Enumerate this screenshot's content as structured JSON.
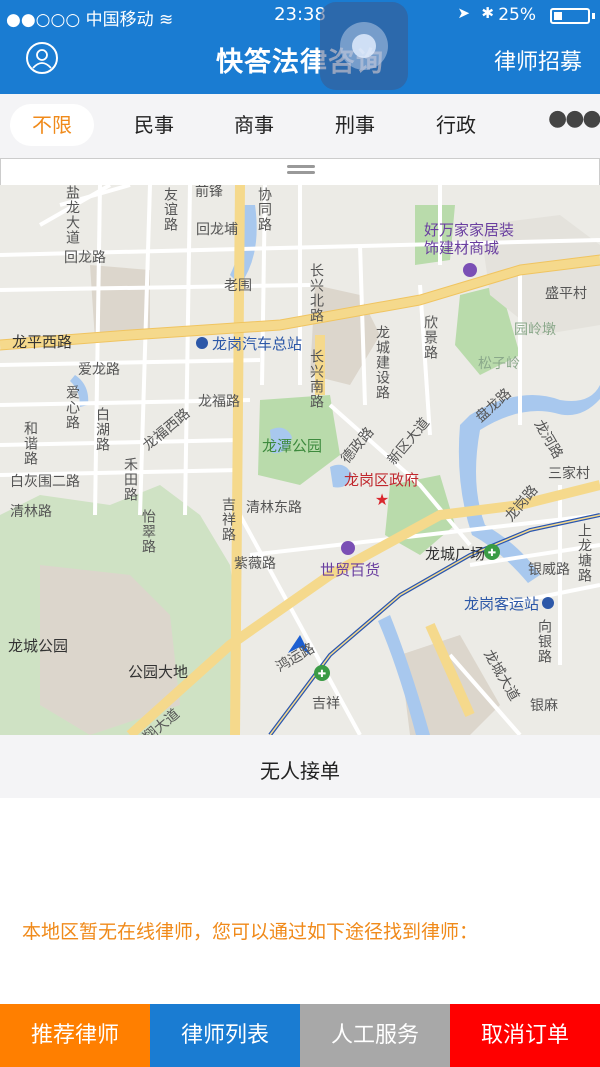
{
  "status_bar": {
    "carrier": "●●○○○ 中国移动 ≋",
    "time": "23:38",
    "battery": "25%",
    "battery_level": 0.25
  },
  "header": {
    "title": "快答法律咨询",
    "recruit_label": "律师招募"
  },
  "tabs": [
    {
      "label": "不限",
      "active": true
    },
    {
      "label": "民事"
    },
    {
      "label": "商事"
    },
    {
      "label": "刑事"
    },
    {
      "label": "行政"
    }
  ],
  "more_label": "●●●",
  "map": {
    "roads": [
      "盐龙大道",
      "友谊路",
      "前锋",
      "协同路",
      "回龙埔",
      "回龙路",
      "老围",
      "长兴北路",
      "好万家家居装饰建材商城",
      "盛平村",
      "龙平西路",
      "龙岗汽车总站",
      "龙城建设路",
      "欣景路",
      "园岭墩",
      "爱龙路",
      "长兴南路",
      "松子岭",
      "爱心路",
      "白湖路",
      "龙福西路",
      "龙福路",
      "盘龙路",
      "和谐路",
      "龙潭公园",
      "德政路",
      "新区大道",
      "龙河路",
      "三家村",
      "白灰围二路",
      "禾田路",
      "龙岗区政府",
      "龙岗路",
      "清林路",
      "怡翠路",
      "吉祥路",
      "清林东路",
      "龙城广场",
      "上龙塘路",
      "紫薇路",
      "世贸百货",
      "银威路",
      "龙岗客运站",
      "龙城公园",
      "向银路",
      "公园大地",
      "鸿运路",
      "龙城大道",
      "吉祥",
      "银麻",
      "翔大道",
      "鸿运"
    ]
  },
  "order_status": "无人接单",
  "notice": "本地区暂无在线律师，您可以通过如下途径找到律师：",
  "bottom_buttons": [
    {
      "label": "推荐律师",
      "color": "#ff7f00"
    },
    {
      "label": "律师列表",
      "color": "#1a7cd2"
    },
    {
      "label": "人工服务",
      "color": "#a8a8a8"
    },
    {
      "label": "取消订单",
      "color": "#ff0000"
    }
  ]
}
